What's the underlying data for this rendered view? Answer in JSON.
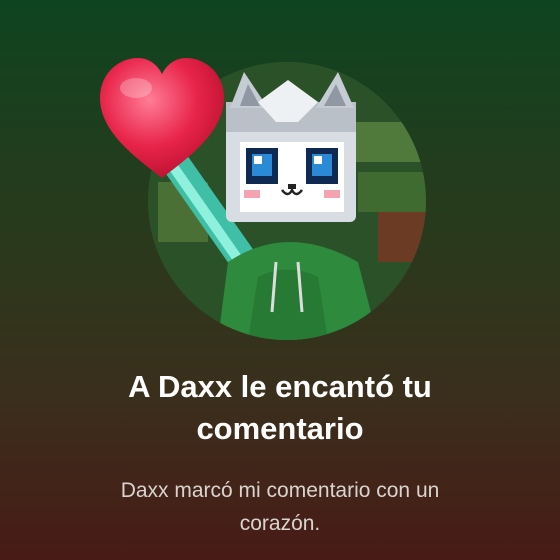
{
  "notification": {
    "title": "A Daxx le encantó tu comentario",
    "message": "Daxx marcó mi comentario con un corazón."
  },
  "avatar": {
    "description_icon": "avatar-image",
    "badge_icon": "heart-icon"
  },
  "colors": {
    "background_top": "#0f4420",
    "background_bottom": "#481b16",
    "heart": "#e8244a",
    "title_text": "#ffffff",
    "message_text": "#d9d4cf"
  }
}
